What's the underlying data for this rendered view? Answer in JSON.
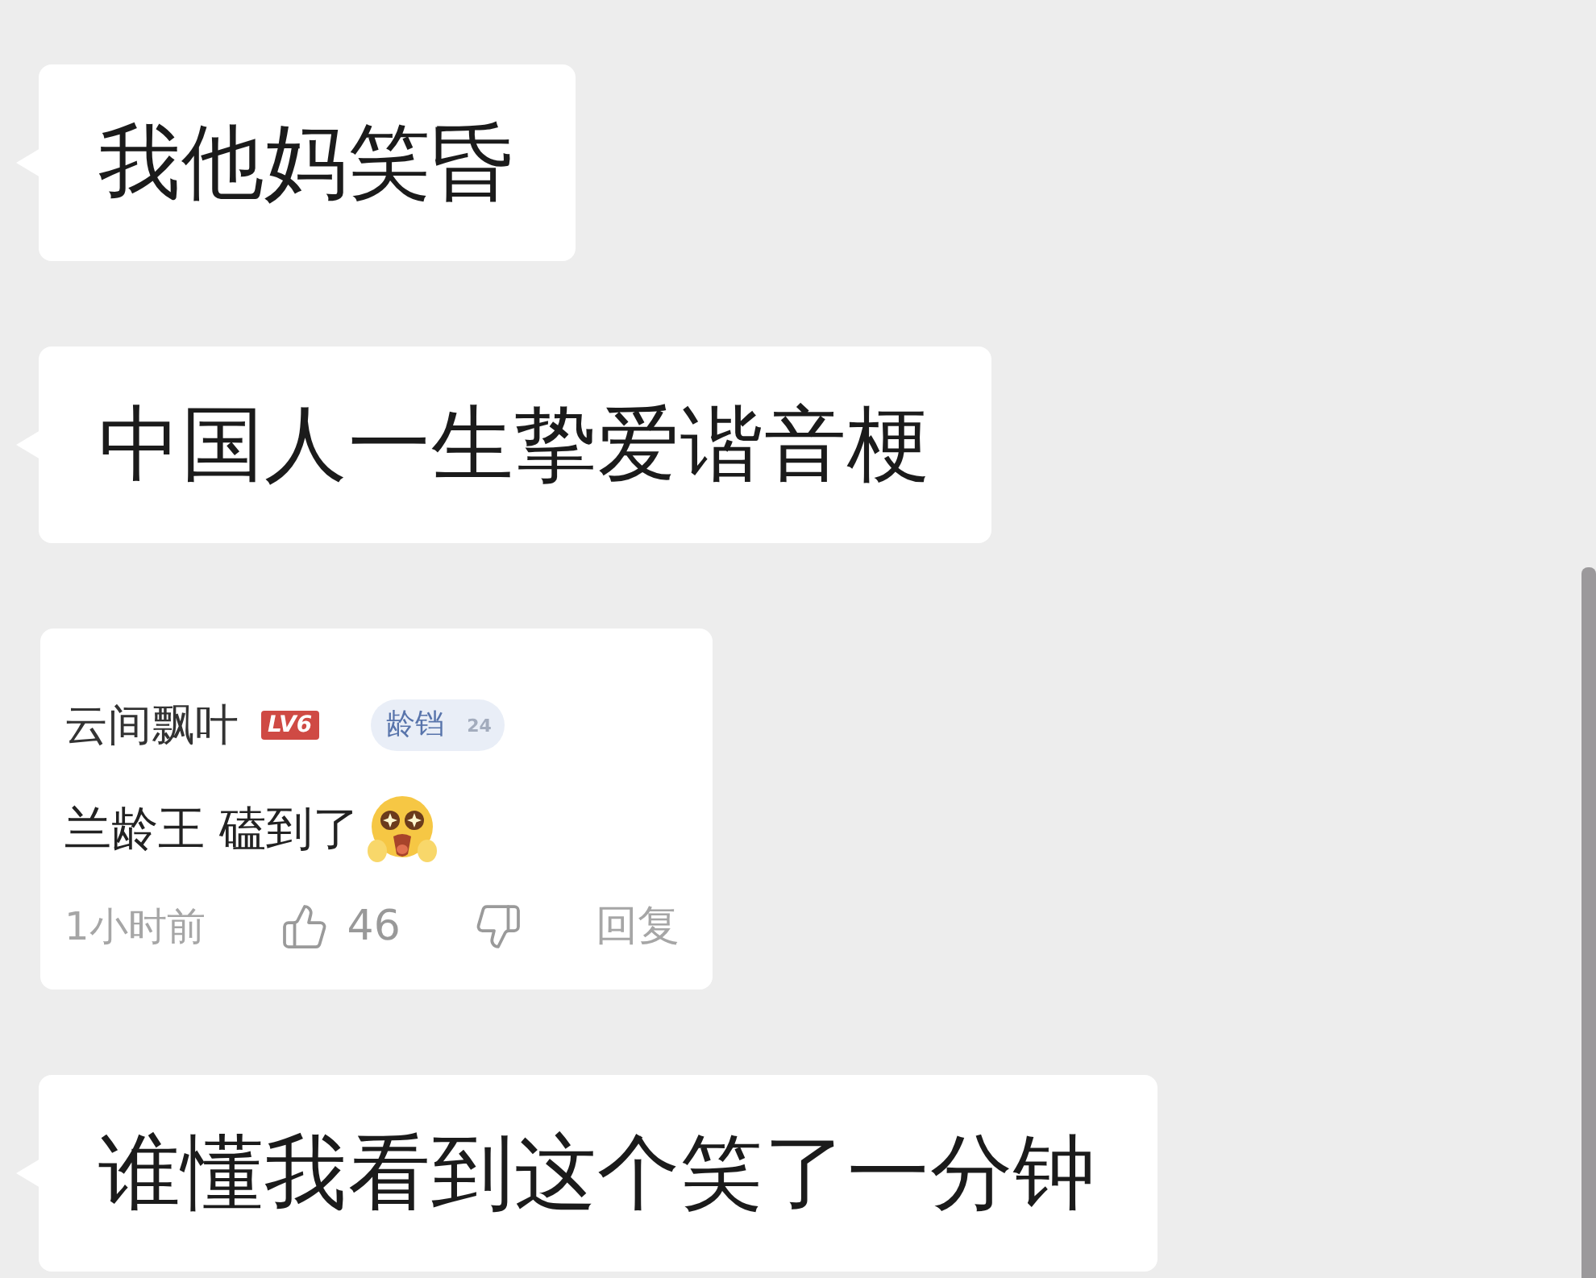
{
  "messages": [
    {
      "kind": "text",
      "text": "我他妈笑昏"
    },
    {
      "kind": "text",
      "text": "中国人一生挚爱谐音梗"
    },
    {
      "kind": "comment_card",
      "username": "云间飘叶",
      "level_badge": "LV6",
      "fan_badge": {
        "name": "龄铛",
        "level": "24"
      },
      "comment": "兰龄王 磕到了",
      "time": "1小时前",
      "likes": "46",
      "reply": "回复"
    },
    {
      "kind": "text",
      "text": "谁懂我看到这个笑了一分钟"
    }
  ]
}
